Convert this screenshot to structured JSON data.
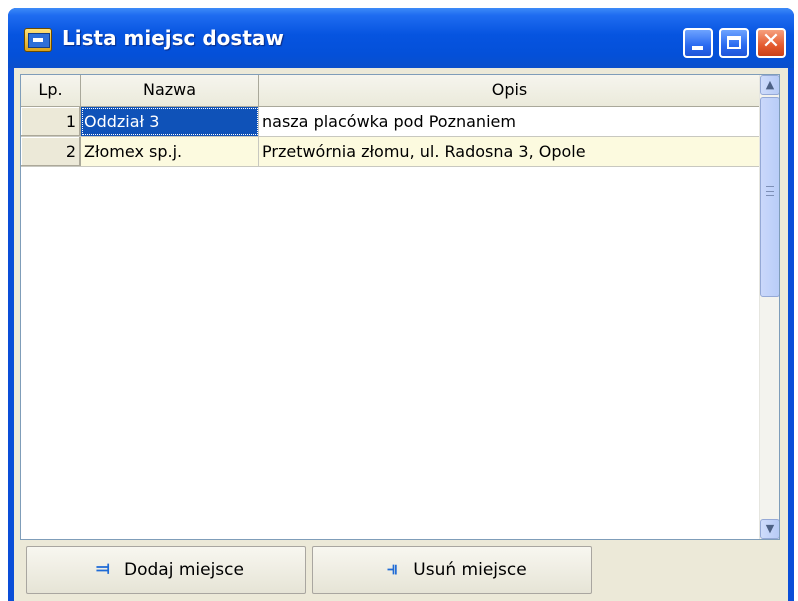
{
  "window": {
    "title": "Lista miejsc dostaw",
    "icon": "app-icon"
  },
  "grid": {
    "columns": [
      "Lp.",
      "Nazwa",
      "Opis"
    ],
    "rows": [
      {
        "lp": "1",
        "nazwa": "Oddział 3",
        "opis": "nasza placówka pod Poznaniem"
      },
      {
        "lp": "2",
        "nazwa": "Złomex sp.j.",
        "opis": "Przetwórnia złomu, ul. Radosna 3, Opole"
      }
    ]
  },
  "buttons": {
    "add_label": "Dodaj miejsce",
    "delete_label": "Usuń miejsce"
  },
  "icons": {
    "add": "add-place-icon",
    "delete": "delete-place-icon"
  },
  "colors": {
    "titlebar": "#0450d8",
    "selection": "#0f52b8",
    "alt_row": "#fcfadf",
    "close_button": "#e45a2e"
  }
}
